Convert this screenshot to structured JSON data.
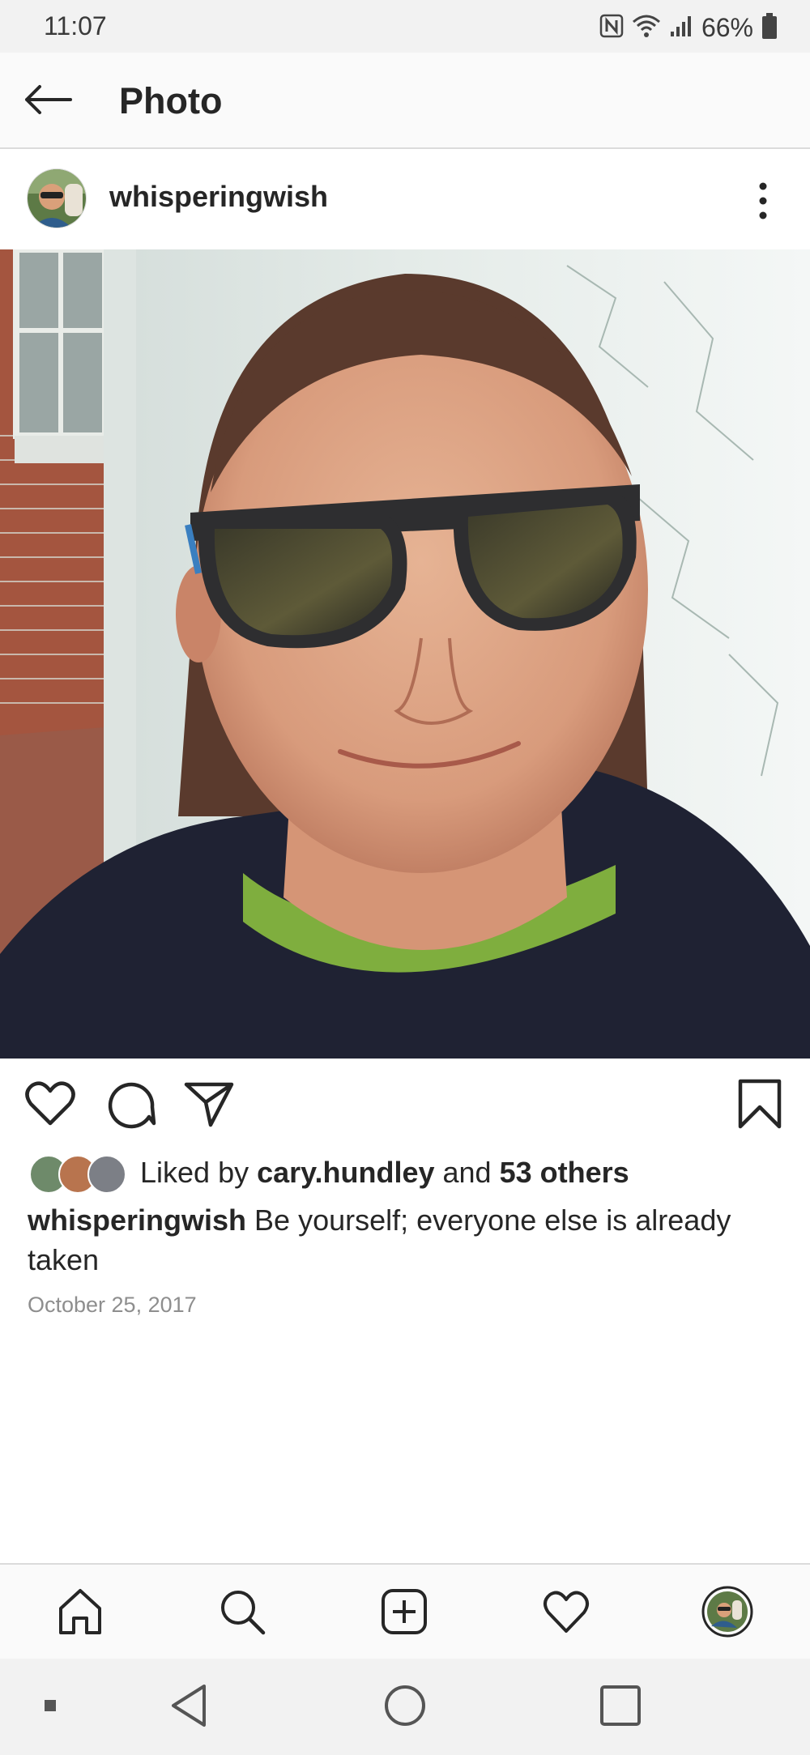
{
  "status_bar": {
    "time": "11:07",
    "battery": "66%",
    "icons": [
      "nfc-icon",
      "wifi-icon",
      "signal-icon",
      "battery-icon"
    ]
  },
  "header": {
    "back_icon": "arrow-left-icon",
    "title": "Photo"
  },
  "post": {
    "username": "whisperingwish",
    "more_icon": "more-vertical-icon",
    "actions": [
      "heart-icon",
      "comment-icon",
      "share-icon",
      "bookmark-icon"
    ],
    "likes": {
      "prefix": "Liked by ",
      "user": "cary.hundley",
      "middle": " and ",
      "others": "53 others"
    },
    "caption": {
      "user": "whisperingwish",
      "text": " Be yourself; everyone else is already taken"
    },
    "date": "October 25, 2017"
  },
  "tab_bar": [
    "home-icon",
    "search-icon",
    "new-post-icon",
    "activity-heart-icon",
    "profile-avatar"
  ],
  "nav_bar": [
    "recents-dot-icon",
    "back-triangle-icon",
    "home-circle-icon",
    "overview-square-icon"
  ],
  "colors": {
    "text": "#262626",
    "secondary_text": "#8e8e8e",
    "divider": "#dbdbdb",
    "bar_background": "#fafafa"
  }
}
